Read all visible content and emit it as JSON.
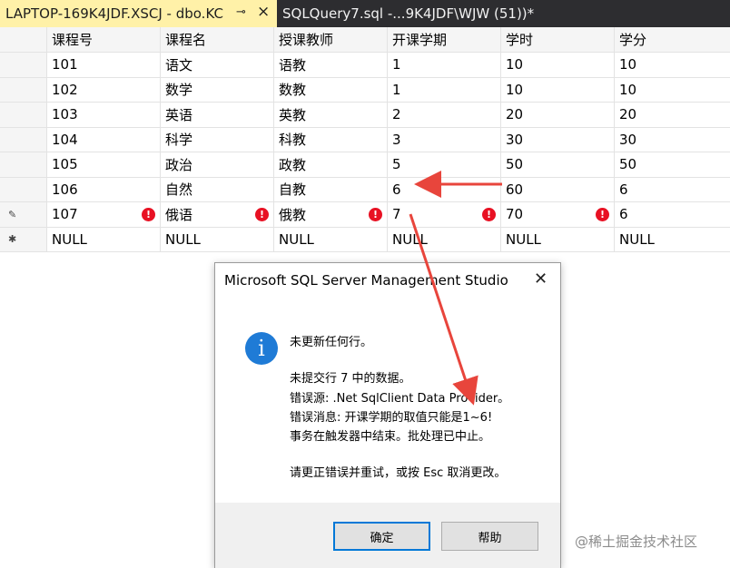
{
  "tabs": {
    "active_label": "LAPTOP-169K4JDF.XSCJ - dbo.KC",
    "inactive_label": "SQLQuery7.sql -...9K4JDF\\WJW (51))*"
  },
  "grid": {
    "columns": [
      "课程号",
      "课程名",
      "授课教师",
      "开课学期",
      "学时",
      "学分"
    ],
    "rows": [
      [
        "101",
        "语文",
        "语教",
        "1",
        "10",
        "10"
      ],
      [
        "102",
        "数学",
        "数教",
        "1",
        "10",
        "10"
      ],
      [
        "103",
        "英语",
        "英教",
        "2",
        "20",
        "20"
      ],
      [
        "104",
        "科学",
        "科教",
        "3",
        "30",
        "30"
      ],
      [
        "105",
        "政治",
        "政教",
        "5",
        "50",
        "50"
      ],
      [
        "106",
        "自然",
        "自教",
        "6",
        "60",
        "6"
      ],
      [
        "107",
        "俄语",
        "俄教",
        "7",
        "70",
        "6"
      ],
      [
        "NULL",
        "NULL",
        "NULL",
        "NULL",
        "NULL",
        "NULL"
      ]
    ],
    "error_glyph": "!"
  },
  "dialog": {
    "title": "Microsoft SQL Server Management Studio",
    "info_glyph": "i",
    "line1": "未更新任何行。",
    "line2": "未提交行 7 中的数据。",
    "line3": "错误源: .Net SqlClient Data Provider。",
    "line4": "错误消息: 开课学期的取值只能是1~6!",
    "line5": "事务在触发器中结束。批处理已中止。",
    "line6": "请更正错误并重试，或按 Esc 取消更改。",
    "ok_label": "确定",
    "help_label": "帮助"
  },
  "watermark": "@稀土掘金技术社区",
  "colors": {
    "accent_tab": "#fff1a8",
    "error_red": "#e81123",
    "info_blue": "#1f7bd6",
    "annotation_arrow": "#e8453c"
  }
}
